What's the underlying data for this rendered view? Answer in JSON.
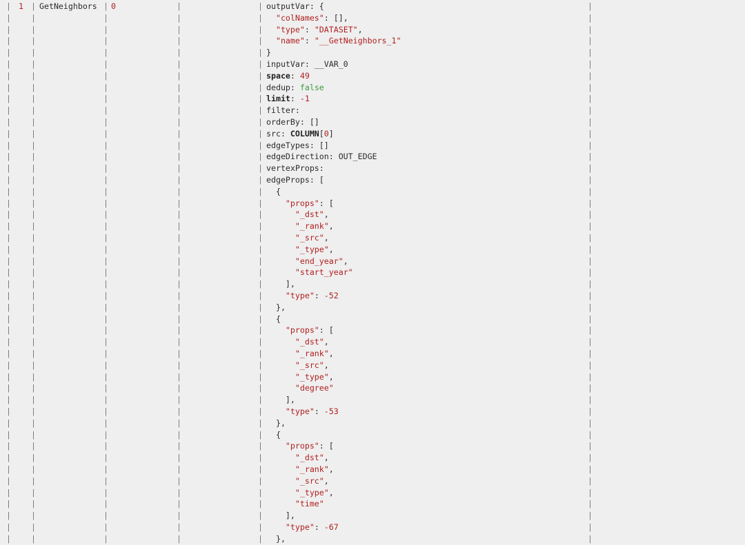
{
  "row": {
    "id": "1",
    "name": "GetNeighbors",
    "deps": "0"
  },
  "pipe_char": "|",
  "detail_lines": [
    [
      {
        "t": "outputVar: {",
        "c": "plain"
      }
    ],
    [
      {
        "t": "  ",
        "c": "plain"
      },
      {
        "t": "\"colNames\"",
        "c": "k-str"
      },
      {
        "t": ": [],",
        "c": "plain"
      }
    ],
    [
      {
        "t": "  ",
        "c": "plain"
      },
      {
        "t": "\"type\"",
        "c": "k-str"
      },
      {
        "t": ": ",
        "c": "plain"
      },
      {
        "t": "\"DATASET\"",
        "c": "k-str"
      },
      {
        "t": ",",
        "c": "plain"
      }
    ],
    [
      {
        "t": "  ",
        "c": "plain"
      },
      {
        "t": "\"name\"",
        "c": "k-str"
      },
      {
        "t": ": ",
        "c": "plain"
      },
      {
        "t": "\"__GetNeighbors_1\"",
        "c": "k-str"
      }
    ],
    [
      {
        "t": "}",
        "c": "plain"
      }
    ],
    [
      {
        "t": "inputVar: __VAR_0",
        "c": "plain"
      }
    ],
    [
      {
        "t": "space",
        "c": "k-bold"
      },
      {
        "t": ": ",
        "c": "plain"
      },
      {
        "t": "49",
        "c": "k-num"
      }
    ],
    [
      {
        "t": "dedup: ",
        "c": "plain"
      },
      {
        "t": "false",
        "c": "k-bool"
      }
    ],
    [
      {
        "t": "limit",
        "c": "k-bold"
      },
      {
        "t": ": ",
        "c": "plain"
      },
      {
        "t": "-1",
        "c": "k-num"
      }
    ],
    [
      {
        "t": "filter:",
        "c": "plain"
      }
    ],
    [
      {
        "t": "orderBy: []",
        "c": "plain"
      }
    ],
    [
      {
        "t": "src: ",
        "c": "plain"
      },
      {
        "t": "COLUMN",
        "c": "k-bold"
      },
      {
        "t": "[",
        "c": "plain"
      },
      {
        "t": "0",
        "c": "k-num"
      },
      {
        "t": "]",
        "c": "plain"
      }
    ],
    [
      {
        "t": "edgeTypes: []",
        "c": "plain"
      }
    ],
    [
      {
        "t": "edgeDirection: OUT_EDGE",
        "c": "plain"
      }
    ],
    [
      {
        "t": "vertexProps:",
        "c": "plain"
      }
    ],
    [
      {
        "t": "edgeProps: [",
        "c": "plain"
      }
    ],
    [
      {
        "t": "  {",
        "c": "plain"
      }
    ],
    [
      {
        "t": "    ",
        "c": "plain"
      },
      {
        "t": "\"props\"",
        "c": "k-str"
      },
      {
        "t": ": [",
        "c": "plain"
      }
    ],
    [
      {
        "t": "      ",
        "c": "plain"
      },
      {
        "t": "\"_dst\"",
        "c": "k-str"
      },
      {
        "t": ",",
        "c": "plain"
      }
    ],
    [
      {
        "t": "      ",
        "c": "plain"
      },
      {
        "t": "\"_rank\"",
        "c": "k-str"
      },
      {
        "t": ",",
        "c": "plain"
      }
    ],
    [
      {
        "t": "      ",
        "c": "plain"
      },
      {
        "t": "\"_src\"",
        "c": "k-str"
      },
      {
        "t": ",",
        "c": "plain"
      }
    ],
    [
      {
        "t": "      ",
        "c": "plain"
      },
      {
        "t": "\"_type\"",
        "c": "k-str"
      },
      {
        "t": ",",
        "c": "plain"
      }
    ],
    [
      {
        "t": "      ",
        "c": "plain"
      },
      {
        "t": "\"end_year\"",
        "c": "k-str"
      },
      {
        "t": ",",
        "c": "plain"
      }
    ],
    [
      {
        "t": "      ",
        "c": "plain"
      },
      {
        "t": "\"start_year\"",
        "c": "k-str"
      }
    ],
    [
      {
        "t": "    ],",
        "c": "plain"
      }
    ],
    [
      {
        "t": "    ",
        "c": "plain"
      },
      {
        "t": "\"type\"",
        "c": "k-str"
      },
      {
        "t": ": ",
        "c": "plain"
      },
      {
        "t": "-52",
        "c": "k-num"
      }
    ],
    [
      {
        "t": "  },",
        "c": "plain"
      }
    ],
    [
      {
        "t": "  {",
        "c": "plain"
      }
    ],
    [
      {
        "t": "    ",
        "c": "plain"
      },
      {
        "t": "\"props\"",
        "c": "k-str"
      },
      {
        "t": ": [",
        "c": "plain"
      }
    ],
    [
      {
        "t": "      ",
        "c": "plain"
      },
      {
        "t": "\"_dst\"",
        "c": "k-str"
      },
      {
        "t": ",",
        "c": "plain"
      }
    ],
    [
      {
        "t": "      ",
        "c": "plain"
      },
      {
        "t": "\"_rank\"",
        "c": "k-str"
      },
      {
        "t": ",",
        "c": "plain"
      }
    ],
    [
      {
        "t": "      ",
        "c": "plain"
      },
      {
        "t": "\"_src\"",
        "c": "k-str"
      },
      {
        "t": ",",
        "c": "plain"
      }
    ],
    [
      {
        "t": "      ",
        "c": "plain"
      },
      {
        "t": "\"_type\"",
        "c": "k-str"
      },
      {
        "t": ",",
        "c": "plain"
      }
    ],
    [
      {
        "t": "      ",
        "c": "plain"
      },
      {
        "t": "\"degree\"",
        "c": "k-str"
      }
    ],
    [
      {
        "t": "    ],",
        "c": "plain"
      }
    ],
    [
      {
        "t": "    ",
        "c": "plain"
      },
      {
        "t": "\"type\"",
        "c": "k-str"
      },
      {
        "t": ": ",
        "c": "plain"
      },
      {
        "t": "-53",
        "c": "k-num"
      }
    ],
    [
      {
        "t": "  },",
        "c": "plain"
      }
    ],
    [
      {
        "t": "  {",
        "c": "plain"
      }
    ],
    [
      {
        "t": "    ",
        "c": "plain"
      },
      {
        "t": "\"props\"",
        "c": "k-str"
      },
      {
        "t": ": [",
        "c": "plain"
      }
    ],
    [
      {
        "t": "      ",
        "c": "plain"
      },
      {
        "t": "\"_dst\"",
        "c": "k-str"
      },
      {
        "t": ",",
        "c": "plain"
      }
    ],
    [
      {
        "t": "      ",
        "c": "plain"
      },
      {
        "t": "\"_rank\"",
        "c": "k-str"
      },
      {
        "t": ",",
        "c": "plain"
      }
    ],
    [
      {
        "t": "      ",
        "c": "plain"
      },
      {
        "t": "\"_src\"",
        "c": "k-str"
      },
      {
        "t": ",",
        "c": "plain"
      }
    ],
    [
      {
        "t": "      ",
        "c": "plain"
      },
      {
        "t": "\"_type\"",
        "c": "k-str"
      },
      {
        "t": ",",
        "c": "plain"
      }
    ],
    [
      {
        "t": "      ",
        "c": "plain"
      },
      {
        "t": "\"time\"",
        "c": "k-str"
      }
    ],
    [
      {
        "t": "    ],",
        "c": "plain"
      }
    ],
    [
      {
        "t": "    ",
        "c": "plain"
      },
      {
        "t": "\"type\"",
        "c": "k-str"
      },
      {
        "t": ": ",
        "c": "plain"
      },
      {
        "t": "-67",
        "c": "k-num"
      }
    ],
    [
      {
        "t": "  },",
        "c": "plain"
      }
    ]
  ],
  "colors": {
    "background": "#efefef",
    "string": "#b01e1e",
    "bool": "#3c9a3c",
    "pipe": "#7a7a7a"
  }
}
